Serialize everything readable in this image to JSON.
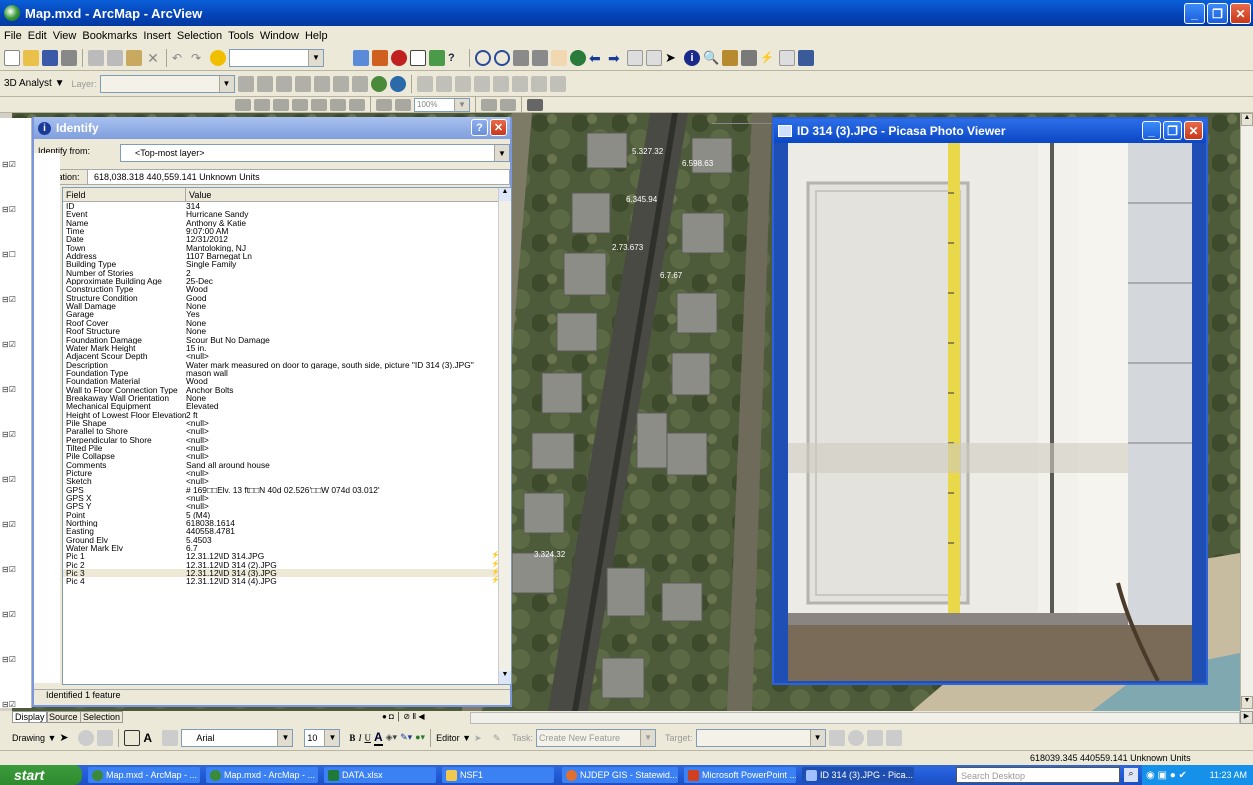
{
  "window": {
    "title": "Map.mxd - ArcMap - ArcView"
  },
  "menu": [
    "File",
    "Edit",
    "View",
    "Bookmarks",
    "Insert",
    "Selection",
    "Tools",
    "Window",
    "Help"
  ],
  "toolbar3d": {
    "analyst": "3D Analyst ▼",
    "layer_label": "Layer:"
  },
  "georef": {
    "zoom": "100%"
  },
  "identify": {
    "title": "Identify",
    "from_label": "Identify from:",
    "from_value": "<Top-most layer>",
    "location_label": "Location:",
    "location_value": "618,038.318  440,559.141 Unknown Units",
    "col_field": "Field",
    "col_value": "Value",
    "footer": "Identified 1 feature",
    "rows": [
      {
        "f": "ID",
        "v": "314"
      },
      {
        "f": "Event",
        "v": "Hurricane Sandy"
      },
      {
        "f": "Name",
        "v": "Anthony & Katie"
      },
      {
        "f": "Time",
        "v": "9:07:00 AM"
      },
      {
        "f": "Date",
        "v": "12/31/2012"
      },
      {
        "f": "Town",
        "v": "Mantoloking, NJ"
      },
      {
        "f": "Address",
        "v": "1107 Barnegat Ln"
      },
      {
        "f": "Building Type",
        "v": "Single Family"
      },
      {
        "f": "Number of Stories",
        "v": "2"
      },
      {
        "f": "Approximate Building Age",
        "v": "25-Dec"
      },
      {
        "f": "Construction Type",
        "v": "Wood"
      },
      {
        "f": "Structure Condition",
        "v": "Good"
      },
      {
        "f": "Wall Damage",
        "v": "None"
      },
      {
        "f": "Garage",
        "v": "Yes"
      },
      {
        "f": "Roof Cover",
        "v": "None"
      },
      {
        "f": "Roof Structure",
        "v": "None"
      },
      {
        "f": "Foundation Damage",
        "v": "Scour But No Damage"
      },
      {
        "f": "Water Mark Height",
        "v": "15 in."
      },
      {
        "f": "Adjacent Scour Depth",
        "v": "<null>"
      },
      {
        "f": "Description",
        "v": "Water mark measured on door to garage, south side, picture \"ID 314 (3).JPG\""
      },
      {
        "f": "Foundation Type",
        "v": "mason wall"
      },
      {
        "f": "Foundation Material",
        "v": "Wood"
      },
      {
        "f": "Wall to Floor Connection Type",
        "v": "Anchor Bolts"
      },
      {
        "f": "Breakaway Wall Orientation",
        "v": "None"
      },
      {
        "f": "Mechanical Equipment",
        "v": "Elevated"
      },
      {
        "f": "Height of Lowest Floor Elevation",
        "v": "2 ft"
      },
      {
        "f": "Pile Shape",
        "v": "<null>"
      },
      {
        "f": "Parallel to Shore",
        "v": "<null>"
      },
      {
        "f": "Perpendicular to Shore",
        "v": "<null>"
      },
      {
        "f": "Tilted Pile",
        "v": "<null>"
      },
      {
        "f": "Pile Collapse",
        "v": "<null>"
      },
      {
        "f": "Comments",
        "v": "Sand all around house"
      },
      {
        "f": "Picture",
        "v": "<null>"
      },
      {
        "f": "Sketch",
        "v": "<null>"
      },
      {
        "f": "GPS",
        "v": "# 169□□Elv. 13 ft□□N 40d 02.526'□□W 074d 03.012'"
      },
      {
        "f": "GPS X",
        "v": "<null>"
      },
      {
        "f": "GPS Y",
        "v": "<null>"
      },
      {
        "f": "Point",
        "v": "5 (M4)"
      },
      {
        "f": "Northing",
        "v": "618038.1614"
      },
      {
        "f": "Easting",
        "v": "440558.4781"
      },
      {
        "f": "Ground Elv",
        "v": "5.4503"
      },
      {
        "f": "Water Mark Elv",
        "v": "6.7"
      },
      {
        "f": "Pic 1",
        "v": "12.31.12\\ID 314.JPG"
      },
      {
        "f": "Pic 2",
        "v": "12.31.12\\ID 314 (2).JPG"
      },
      {
        "f": "Pic 3",
        "v": "12.31.12\\ID 314 (3).JPG"
      },
      {
        "f": "Pic 4",
        "v": "12.31.12\\ID 314 (4).JPG"
      }
    ]
  },
  "picasa": {
    "title": "ID 314 (3).JPG - Picasa Photo Viewer"
  },
  "map_labels": [
    "5.327.32",
    "6.598.63",
    "6.345.94",
    "2.73.673",
    "6.7.67",
    "3.324.32"
  ],
  "view_tabs": [
    "Display",
    "Source",
    "Selection"
  ],
  "drawing": {
    "label": "Drawing ▼",
    "font": "Arial",
    "size": "10"
  },
  "editor": {
    "label": "Editor ▼",
    "task_label": "Task:",
    "task_value": "Create New Feature",
    "target_label": "Target:"
  },
  "status": {
    "coords": "618039.345  440559.141 Unknown Units"
  },
  "taskbar": {
    "start": "start",
    "items": [
      "Map.mxd - ArcMap - ...",
      "Map.mxd - ArcMap - ...",
      "DATA.xlsx",
      "NSF1",
      "NJDEP GIS - Statewid...",
      "Microsoft PowerPoint ...",
      "ID 314 (3).JPG - Pica..."
    ],
    "search": "Search Desktop",
    "clock": "11:23 AM"
  }
}
